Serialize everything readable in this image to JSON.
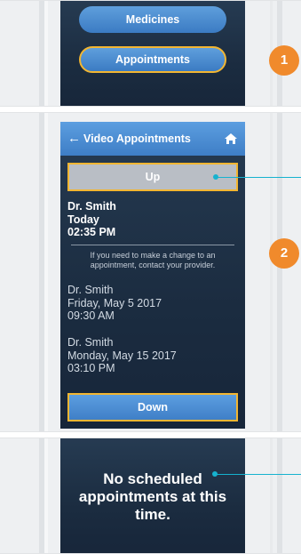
{
  "panel1": {
    "medicines_label": "Medicines",
    "appointments_label": "Appointments",
    "step_badge": "1"
  },
  "panel2": {
    "header": {
      "title": "Video Appointments",
      "back_icon": "arrow-left-icon",
      "home_icon": "home-icon"
    },
    "up_label": "Up",
    "down_label": "Down",
    "step_badge": "2",
    "appointments": [
      {
        "doctor": "Dr. Smith",
        "date": "Today",
        "time": "02:35 PM"
      },
      {
        "doctor": "Dr. Smith",
        "date": "Friday, May  5 2017",
        "time": "09:30 AM"
      },
      {
        "doctor": "Dr. Smith",
        "date": "Monday, May 15 2017",
        "time": "03:10 PM"
      }
    ],
    "note": "If you need to make a change to an appointment, contact your provider."
  },
  "panel3": {
    "empty_message": "No scheduled appointments at this time."
  },
  "colors": {
    "accent_orange": "#f08a2c",
    "highlight_yellow": "#f2b632",
    "leader_cyan": "#16b2cf",
    "button_blue": "#4a8ad0",
    "screen_navy": "#1f3147"
  }
}
